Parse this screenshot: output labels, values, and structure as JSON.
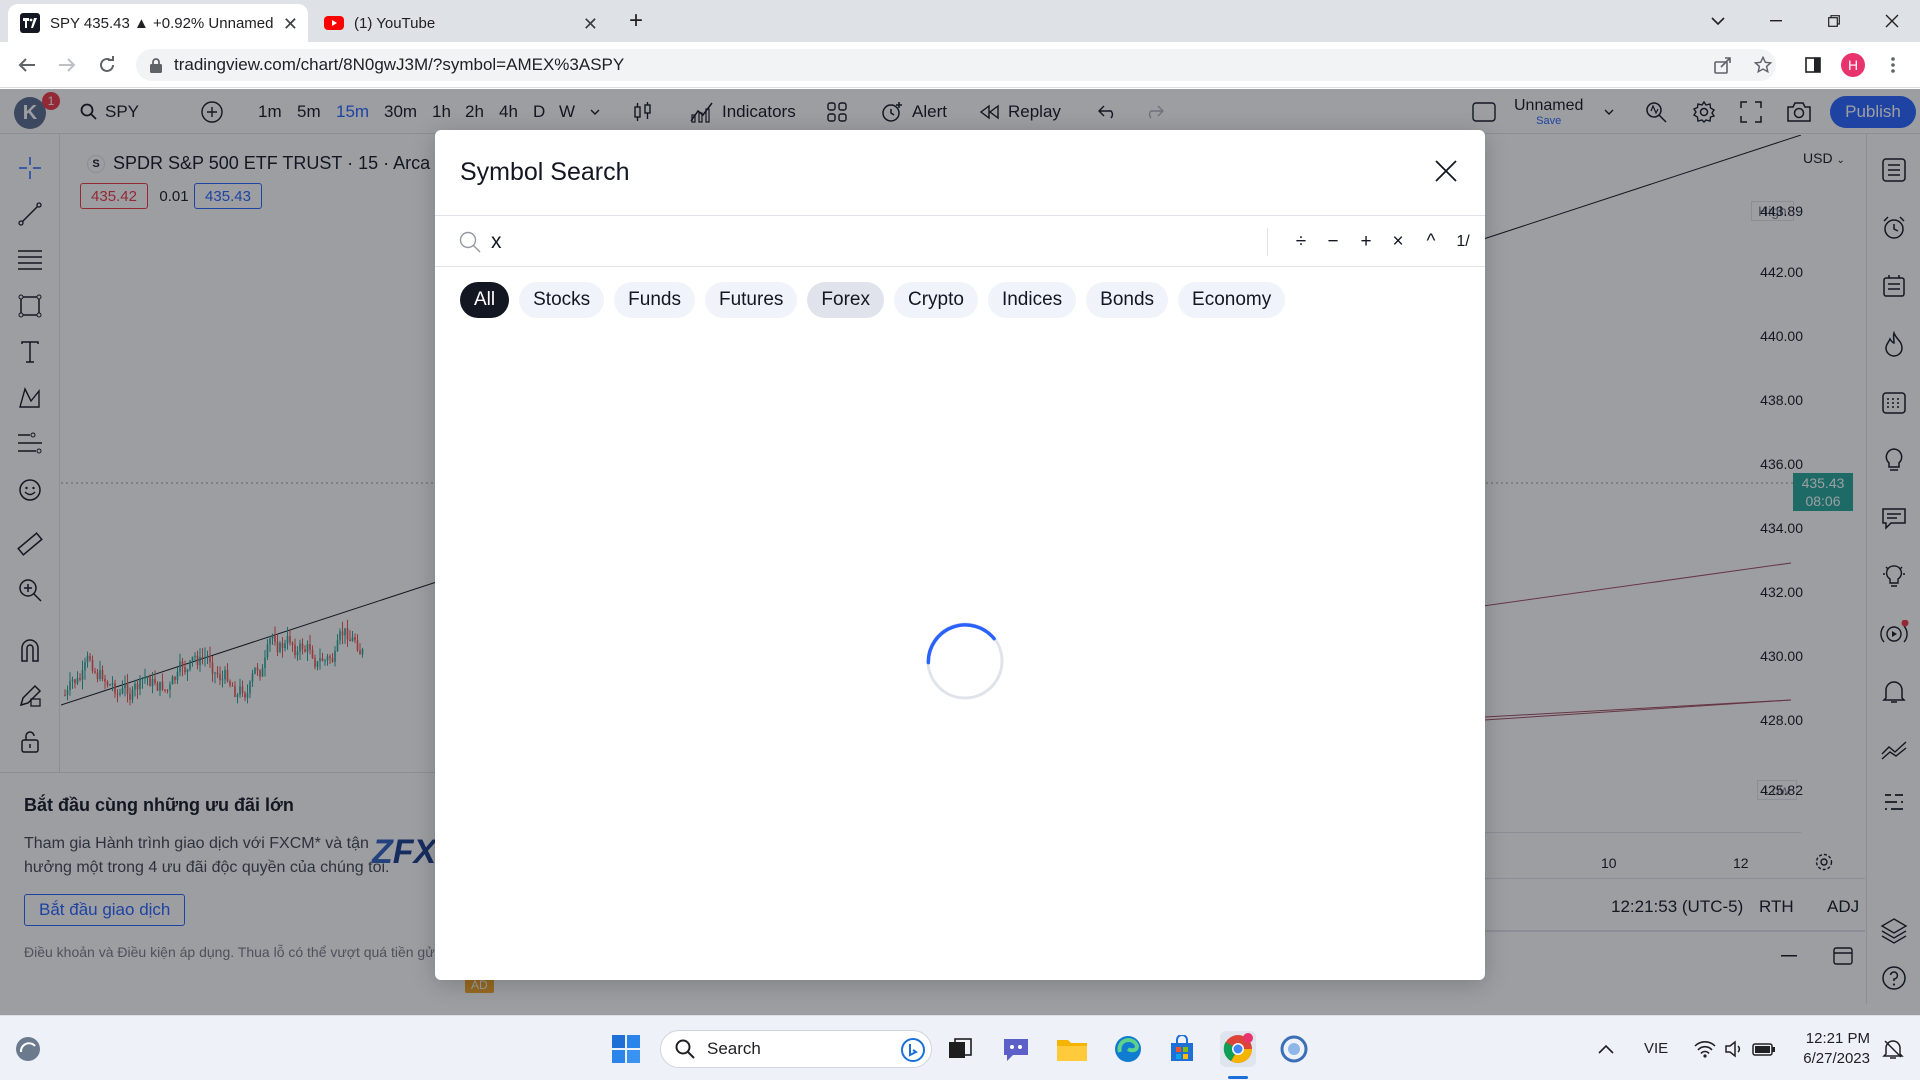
{
  "browser": {
    "tabs": [
      {
        "title": "SPY 435.43 ▲ +0.92% Unnamed",
        "favicon": "tradingview-icon"
      },
      {
        "title": "(1) YouTube",
        "favicon": "youtube-icon"
      }
    ],
    "url": "tradingview.com/chart/8N0gwJ3M/?symbol=AMEX%3ASPY",
    "profile_initial": "H"
  },
  "toolbar": {
    "avatar_initial": "K",
    "avatar_badge": "1",
    "symbol": "SPY",
    "intervals": [
      "1m",
      "5m",
      "15m",
      "30m",
      "1h",
      "2h",
      "4h",
      "D",
      "W"
    ],
    "active_interval": "15m",
    "indicators_label": "Indicators",
    "alert_label": "Alert",
    "replay_label": "Replay",
    "layout_name": "Unnamed",
    "layout_save": "Save",
    "publish_label": "Publish"
  },
  "chart": {
    "symbol_title": "SPDR S&P 500 ETF TRUST · 15 · Arca",
    "symbol_badge": "S",
    "bid": "435.42",
    "spread": "0.01",
    "ask": "435.43",
    "currency": "USD",
    "high_label": "High",
    "high_value": "443.89",
    "low_label": "Low",
    "low_value": "425.82",
    "current_price": "435.43",
    "countdown": "08:06",
    "y_ticks": [
      "442.00",
      "440.00",
      "438.00",
      "436.00",
      "434.00",
      "432.00",
      "430.00",
      "428.00"
    ],
    "x_ticks": [
      "10",
      "12"
    ],
    "clock": "12:21:53 (UTC-5)",
    "session": "RTH",
    "adj": "ADJ"
  },
  "ad": {
    "title": "Bắt đầu cùng những ưu đãi lớn",
    "body": "Tham gia Hành trình giao dịch với FXCM* và tận hưởng một trong 4 ưu đãi độc quyền của chúng tôi.",
    "button": "Bắt đầu giao dịch",
    "terms": "Điều khoản và Điều kiện áp dụng. Thua lỗ có thể vượt quá tiền gửi.",
    "logo": "FX",
    "tag": "AD"
  },
  "modal": {
    "title": "Symbol Search",
    "query": "x",
    "calc_buttons": [
      "÷",
      "−",
      "+",
      "×",
      "^",
      "1/"
    ],
    "filters": [
      "All",
      "Stocks",
      "Funds",
      "Futures",
      "Forex",
      "Crypto",
      "Indices",
      "Bonds",
      "Economy"
    ],
    "active_filter": "All",
    "hover_filter": "Forex"
  },
  "taskbar": {
    "search_label": "Search",
    "language": "VIE",
    "time": "12:21 PM",
    "date": "6/27/2023"
  },
  "colors": {
    "accent": "#2962ff",
    "bid": "#f23645",
    "ask": "#2962ff",
    "current_price_bg": "#26a69a"
  }
}
